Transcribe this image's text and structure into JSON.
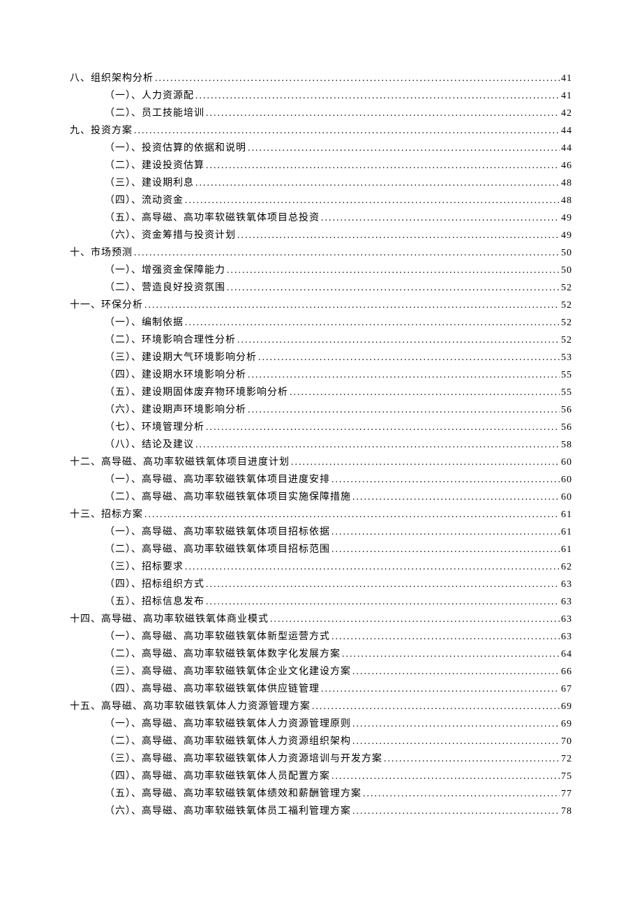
{
  "toc": [
    {
      "level": 1,
      "label": "八、组织架构分析",
      "page": "41"
    },
    {
      "level": 2,
      "label": "（一）、人力资源配",
      "page": "41"
    },
    {
      "level": 2,
      "label": "（二）、员工技能培训",
      "page": "42"
    },
    {
      "level": 1,
      "label": "九、投资方案",
      "page": "44"
    },
    {
      "level": 2,
      "label": "（一）、投资估算的依据和说明",
      "page": "44"
    },
    {
      "level": 2,
      "label": "（二）、建设投资估算",
      "page": "46"
    },
    {
      "level": 2,
      "label": "（三）、建设期利息",
      "page": "48"
    },
    {
      "level": 2,
      "label": "（四）、流动资金",
      "page": "48"
    },
    {
      "level": 2,
      "label": "（五）、高导磁、高功率软磁铁氧体项目总投资",
      "page": "49"
    },
    {
      "level": 2,
      "label": "（六）、资金筹措与投资计划",
      "page": "49"
    },
    {
      "level": 1,
      "label": "十、市场预测",
      "page": "50"
    },
    {
      "level": 2,
      "label": "（一）、增强资金保障能力",
      "page": "50"
    },
    {
      "level": 2,
      "label": "（二）、营造良好投资氛围",
      "page": "52"
    },
    {
      "level": 1,
      "label": "十一、环保分析",
      "page": "52"
    },
    {
      "level": 2,
      "label": "（一）、编制依据",
      "page": "52"
    },
    {
      "level": 2,
      "label": "（二）、环境影响合理性分析",
      "page": "52"
    },
    {
      "level": 2,
      "label": "（三）、建设期大气环境影响分析",
      "page": "53"
    },
    {
      "level": 2,
      "label": "（四）、建设期水环境影响分析",
      "page": "55"
    },
    {
      "level": 2,
      "label": "（五）、建设期固体废弃物环境影响分析",
      "page": "55"
    },
    {
      "level": 2,
      "label": "（六）、建设期声环境影响分析",
      "page": "56"
    },
    {
      "level": 2,
      "label": "（七）、环境管理分析",
      "page": "56"
    },
    {
      "level": 2,
      "label": "（八）、结论及建议",
      "page": "58"
    },
    {
      "level": 1,
      "label": "十二、高导磁、高功率软磁铁氧体项目进度计划",
      "page": "60"
    },
    {
      "level": 2,
      "label": "（一）、高导磁、高功率软磁铁氧体项目进度安排",
      "page": "60"
    },
    {
      "level": 2,
      "label": "（二）、高导磁、高功率软磁铁氧体项目实施保障措施",
      "page": "60"
    },
    {
      "level": 1,
      "label": "十三、招标方案",
      "page": "61"
    },
    {
      "level": 2,
      "label": "（一）、高导磁、高功率软磁铁氧体项目招标依据",
      "page": "61"
    },
    {
      "level": 2,
      "label": "（二）、高导磁、高功率软磁铁氧体项目招标范围",
      "page": "61"
    },
    {
      "level": 2,
      "label": "（三）、招标要求",
      "page": "62"
    },
    {
      "level": 2,
      "label": "（四）、招标组织方式",
      "page": "63"
    },
    {
      "level": 2,
      "label": "（五）、招标信息发布",
      "page": "63"
    },
    {
      "level": 1,
      "label": "十四、高导磁、高功率软磁铁氧体商业模式",
      "page": "63"
    },
    {
      "level": 2,
      "label": "（一）、高导磁、高功率软磁铁氧体新型运营方式",
      "page": "63"
    },
    {
      "level": 2,
      "label": "（二）、高导磁、高功率软磁铁氧体数字化发展方案",
      "page": "64"
    },
    {
      "level": 2,
      "label": "（三）、高导磁、高功率软磁铁氧体企业文化建设方案",
      "page": "66"
    },
    {
      "level": 2,
      "label": "（四）、高导磁、高功率软磁铁氧体供应链管理",
      "page": "67"
    },
    {
      "level": 1,
      "label": "十五、高导磁、高功率软磁铁氧体人力资源管理方案",
      "page": "69"
    },
    {
      "level": 2,
      "label": "（一）、高导磁、高功率软磁铁氧体人力资源管理原则",
      "page": "69"
    },
    {
      "level": 2,
      "label": "（二）、高导磁、高功率软磁铁氧体人力资源组织架构",
      "page": "70"
    },
    {
      "level": 2,
      "label": "（三）、高导磁、高功率软磁铁氧体人力资源培训与开发方案",
      "page": "72"
    },
    {
      "level": 2,
      "label": "（四）、高导磁、高功率软磁铁氧体人员配置方案",
      "page": "75"
    },
    {
      "level": 2,
      "label": "（五）、高导磁、高功率软磁铁氧体绩效和薪酬管理方案",
      "page": "77"
    },
    {
      "level": 2,
      "label": "（六）、高导磁、高功率软磁铁氧体员工福利管理方案",
      "page": "78"
    }
  ]
}
